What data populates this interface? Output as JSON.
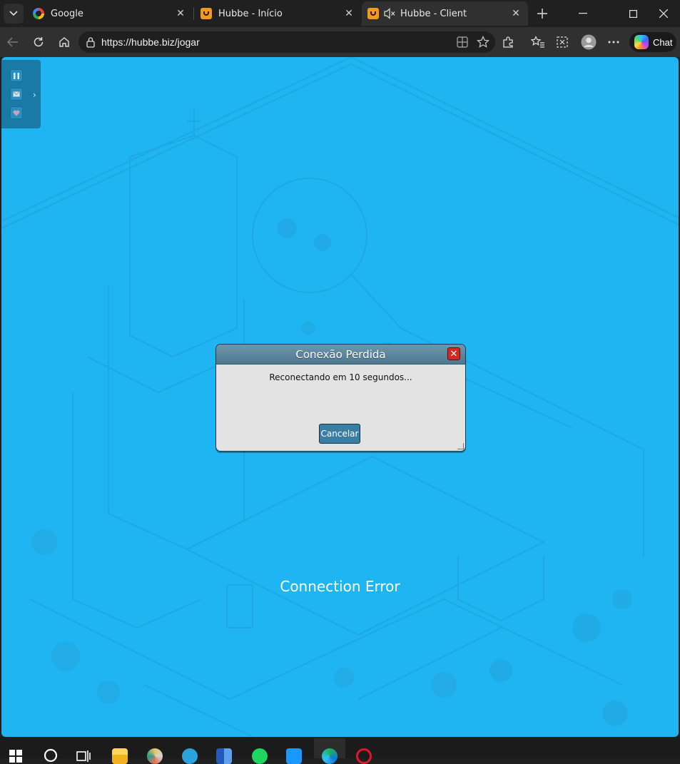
{
  "browser": {
    "tabs": [
      {
        "title": "Google",
        "icon": "google-favicon",
        "active": false
      },
      {
        "title": "Hubbe - Início",
        "icon": "hubbe-favicon",
        "active": false
      },
      {
        "title": "Hubbe - Client",
        "icon": "hubbe-favicon",
        "active": true,
        "muted": true
      }
    ],
    "url": "https://hubbe.biz/jogar",
    "chat_label": "Chat"
  },
  "game": {
    "background_color": "#1eb5f2",
    "side_panel": {
      "buttons": [
        "pause-icon",
        "mail-icon",
        "heart-icon"
      ]
    },
    "dialog": {
      "title": "Conexão Perdida",
      "message": "Reconectando em 10 segundos...",
      "button": "Cancelar"
    },
    "status": "Connection Error"
  },
  "taskbar": {
    "items": [
      "windows-start-icon",
      "search-icon",
      "task-view-icon",
      "file-explorer-icon",
      "paint-icon",
      "telegram-icon",
      "word-icon",
      "spotify-icon",
      "prime-video-icon",
      "edge-icon",
      "opera-icon"
    ]
  }
}
